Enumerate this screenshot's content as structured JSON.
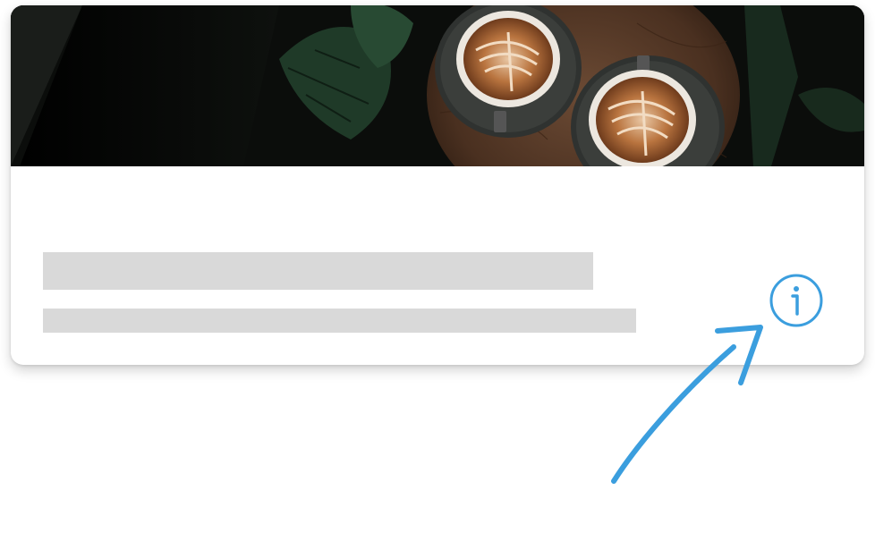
{
  "card": {
    "hero_image": "coffee-latte-art-photo",
    "skeleton_color": "#d9d9d9"
  },
  "info": {
    "icon": "info-icon",
    "color": "#3b9ede"
  },
  "annotation": {
    "icon": "hand-drawn-arrow",
    "color": "#3b9ede"
  }
}
